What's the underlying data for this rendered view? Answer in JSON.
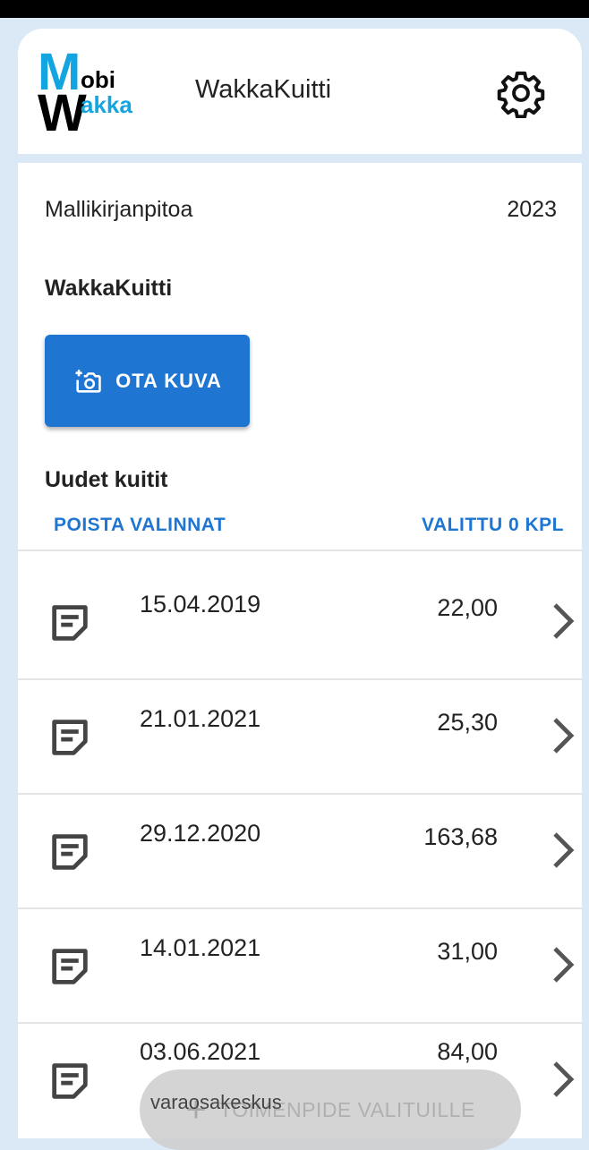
{
  "header": {
    "logo": {
      "line1_big": "M",
      "line1_small": "obi",
      "line2_big": "W",
      "line2_small": "akka"
    },
    "title": "WakkaKuitti",
    "settings_icon": "gear-icon"
  },
  "company": {
    "name": "Mallikirjanpitoa",
    "year": "2023"
  },
  "section_title": "WakkaKuitti",
  "camera_button": {
    "label": "OTA KUVA",
    "icon": "camera-plus-icon"
  },
  "receipts_section": {
    "title": "Uudet kuitit",
    "clear_selection": "POISTA VALINNAT",
    "selected_count": "VALITTU 0 KPL"
  },
  "receipts": [
    {
      "date": "15.04.2019",
      "amount": "22,00"
    },
    {
      "date": "21.01.2021",
      "amount": "25,30"
    },
    {
      "date": "29.12.2020",
      "amount": "163,68"
    },
    {
      "date": "14.01.2021",
      "amount": "31,00"
    },
    {
      "date": "03.06.2021",
      "amount": "84,00",
      "subtitle": "varaosakeskus"
    }
  ],
  "fab": {
    "label": "TOIMENPIDE VALITUILLE",
    "icon": "plus-icon"
  },
  "colors": {
    "accent": "#1f76d2",
    "logo_blue": "#12a5e0",
    "background": "#dbe9f6"
  }
}
